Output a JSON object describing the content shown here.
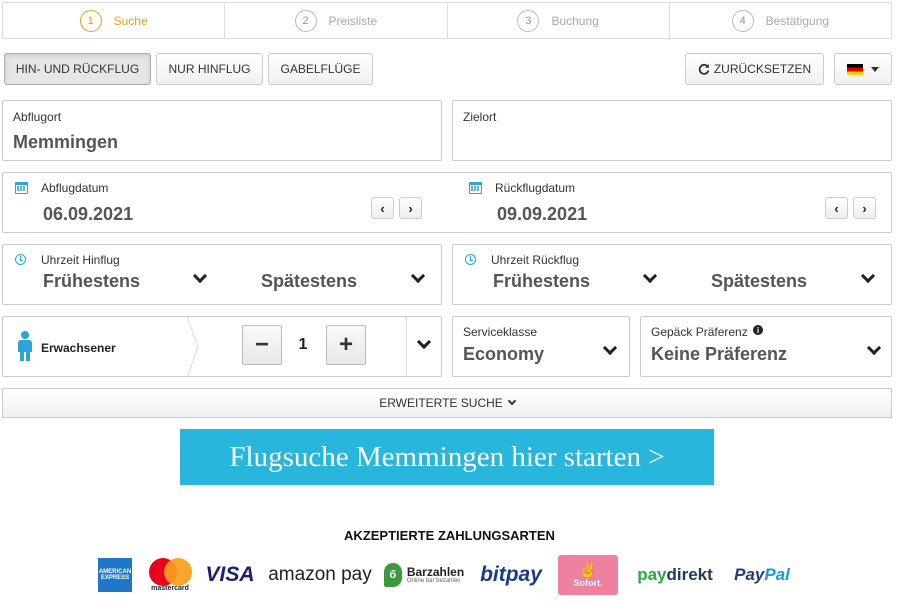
{
  "steps": [
    {
      "num": "1",
      "label": "Suche"
    },
    {
      "num": "2",
      "label": "Preisliste"
    },
    {
      "num": "3",
      "label": "Buchung"
    },
    {
      "num": "4",
      "label": "Bestätigung"
    }
  ],
  "trip_types": {
    "round_trip": "HIN- UND RÜCKFLUG",
    "one_way": "NUR HINFLUG",
    "open_jaw": "GABELFLÜGE"
  },
  "reset_label": "ZURÜCKSETZEN",
  "origin": {
    "label": "Abflugort",
    "value": "Memmingen"
  },
  "destination": {
    "label": "Zielort",
    "value": ""
  },
  "departure_date": {
    "label": "Abflugdatum",
    "value": "06.09.2021"
  },
  "return_date": {
    "label": "Rückflugdatum",
    "value": "09.09.2021"
  },
  "outbound_time": {
    "label": "Uhrzeit Hinflug",
    "earliest": "Frühestens",
    "latest": "Spätestens"
  },
  "return_time": {
    "label": "Uhrzeit Rückflug",
    "earliest": "Frühestens",
    "latest": "Spätestens"
  },
  "passengers": {
    "label": "Erwachsener",
    "count": "1",
    "minus": "−",
    "plus": "+"
  },
  "service_class": {
    "label": "Serviceklasse",
    "value": "Economy"
  },
  "baggage": {
    "label": "Gepäck Präferenz",
    "value": "Keine Präferenz"
  },
  "advanced_search": "ERWEITERTE SUCHE",
  "cta": "Flugsuche Memmingen hier starten >",
  "payment_title": "AKZEPTIERTE ZAHLUNGSARTEN",
  "payments": {
    "amex": "AMERICAN EXPRESS",
    "mastercard": "mastercard",
    "visa": "VISA",
    "amazon": "amazon pay",
    "barzahlen": "Barzahlen",
    "barzahlen_sub": "Online bar bezahlen",
    "bitpay": "bitpay",
    "sofort": "Sofort.",
    "paydirekt_a": "pay",
    "paydirekt_b": "direkt",
    "paypal_a": "Pay",
    "paypal_b": "Pal"
  },
  "colors": {
    "accent": "#29b6dc",
    "active_step": "#e8a317"
  },
  "icons": {
    "calendar": "calendar-icon",
    "clock": "clock-icon",
    "person": "person-icon",
    "refresh": "refresh-icon",
    "flag": "germany-flag-icon"
  }
}
